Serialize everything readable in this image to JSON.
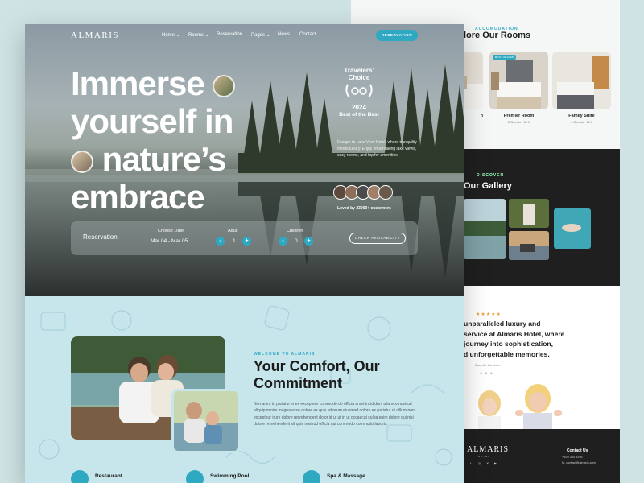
{
  "brand": "ALMARIS",
  "nav": {
    "items": [
      "Home",
      "Rooms",
      "Reservation",
      "Pages",
      "News",
      "Contact"
    ],
    "cta": "RESERVATION"
  },
  "hero": {
    "headline_line1": "Immerse",
    "headline_line2": "yourself in",
    "headline_line3": "nature’s",
    "headline_line4": "embrace",
    "badge_title_line1": "Travelers’",
    "badge_title_line2": "Choice",
    "badge_year": "2024",
    "badge_best": "Best of the Best",
    "description": "Escape to Lake View Hotel, where tranquility meets luxury. Enjoy breathtaking lake views, cozy rooms, and topifer amenities.",
    "loved": "Loved by 23000+ customers"
  },
  "reservation": {
    "title": "Reservation",
    "date_label": "Choose Date",
    "date_value": "Mar 04 - Mar 05",
    "adult_label": "Adult",
    "adult_value": "1",
    "children_label": "Children",
    "children_value": "0",
    "minus": "-",
    "plus": "+",
    "check_button": "CHECK AVAILABILITY"
  },
  "welcome": {
    "eyebrow": "WELCOME TO ALMARIS",
    "title_line1": "Your Comfort, Our",
    "title_line2": "Commitment",
    "body": "Non anim in pariatur in ex excepteur commodo do officia amet incididunt ullamco nostrud aliquip minim magna esse dolore ex quis laborum eiusmod dolore ex pariatur ut cillum non excepteur irure dolore reprehenderit dolor id ut ut in ut occaecat culpa enim dolore qui nisi dolore reprehenderit sit quis nostrud officia qui commodo commodo laboris."
  },
  "amenities": [
    "Restaurant",
    "Swimming Pool",
    "Spa & Massage"
  ],
  "rooms": {
    "eyebrow": "ACCOMODATION",
    "title": "lore Our Rooms",
    "badge": "BEST SELLER",
    "cards": [
      {
        "name": "n",
        "meta": ""
      },
      {
        "name": "Premier Room",
        "meta": "2 Guests · 30 ft"
      },
      {
        "name": "Family Suite",
        "meta": "4 Guests · 40 ft"
      }
    ]
  },
  "gallery": {
    "eyebrow": "DISCOVER",
    "title": "Our Gallery"
  },
  "testimonial": {
    "stars": "★★★★★",
    "text_line1": "unparalleled luxury and",
    "text_line2": "service at Almaris Hotel, where",
    "text_line3": "journey into sophistication,",
    "text_line4": "d unforgettable memories.",
    "author": "Danielle Fandrien",
    "dots": "● ● ●"
  },
  "footer": {
    "logo": "ALMARIS",
    "sub": "HOTEL",
    "contact_title": "Contact Us",
    "phone": "+929 333 9296",
    "email": "M: contact@almaris.com"
  },
  "colors": {
    "accent": "#2fa9c2",
    "welcome_bg": "#c7e6ec",
    "dark_bg": "#1f1f1f"
  }
}
